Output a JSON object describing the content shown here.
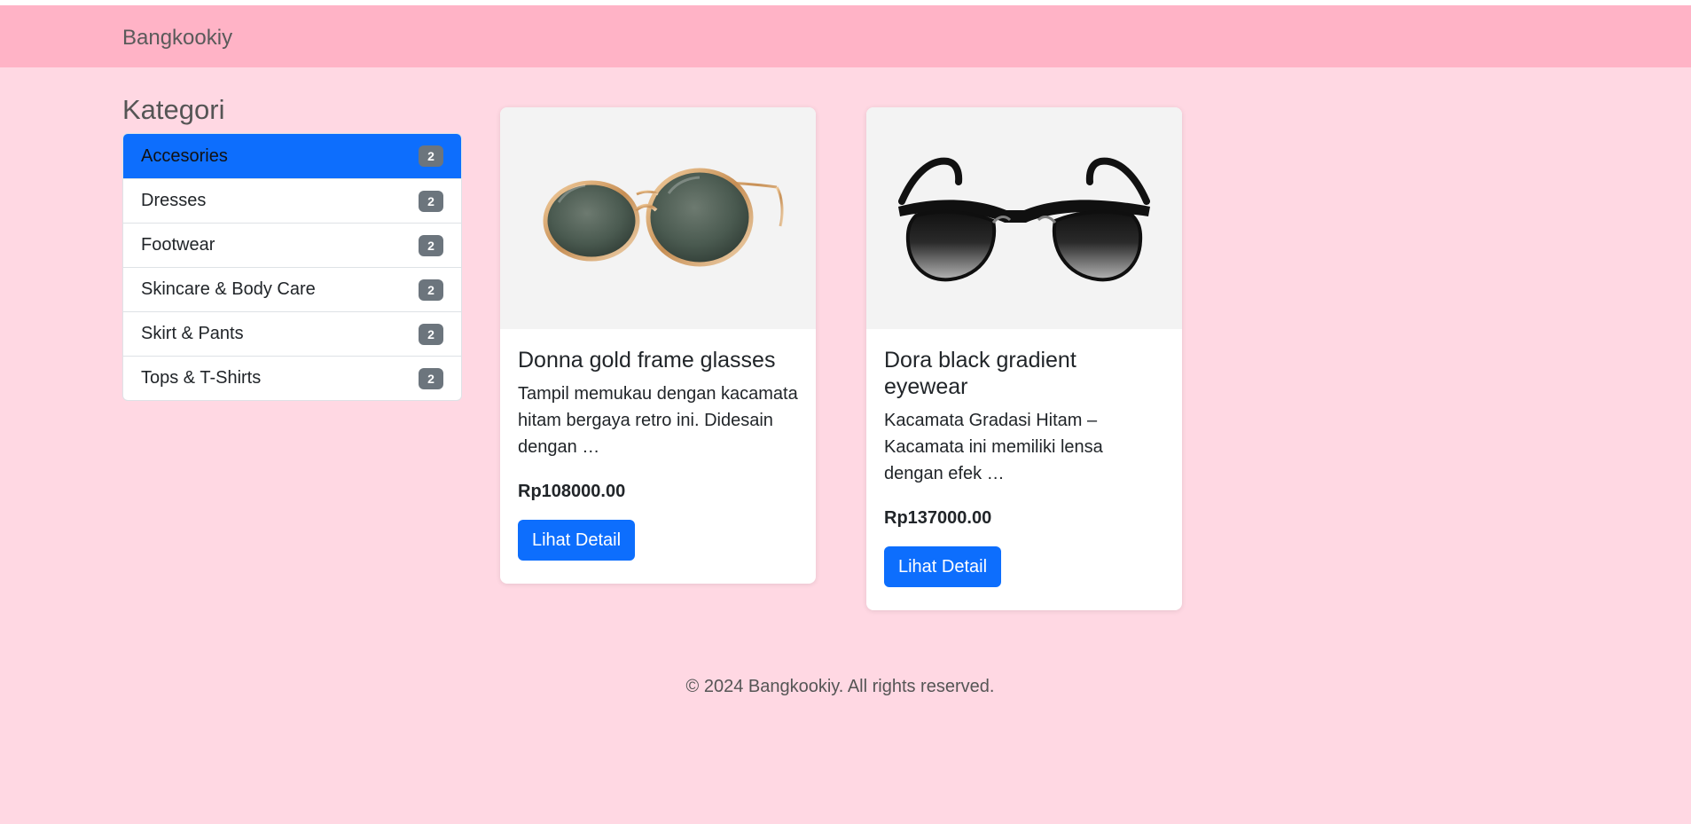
{
  "header": {
    "brand": "Bangkookiy"
  },
  "sidebar": {
    "title": "Kategori",
    "items": [
      {
        "label": "Accesories",
        "count": "2"
      },
      {
        "label": "Dresses",
        "count": "2"
      },
      {
        "label": "Footwear",
        "count": "2"
      },
      {
        "label": "Skincare & Body Care",
        "count": "2"
      },
      {
        "label": "Skirt & Pants",
        "count": "2"
      },
      {
        "label": "Tops & T-Shirts",
        "count": "2"
      }
    ]
  },
  "products": [
    {
      "name": "Donna gold frame glasses",
      "description": "Tampil memukau dengan kacamata hitam bergaya retro ini. Didesain dengan …",
      "price": "Rp108000.00",
      "button_label": "Lihat Detail",
      "image_icon": "gold-frame-sunglasses-icon"
    },
    {
      "name": "Dora black gradient eyewear",
      "description": "Kacamata Gradasi Hitam – Kacamata ini memiliki lensa dengan efek …",
      "price": "Rp137000.00",
      "button_label": "Lihat Detail",
      "image_icon": "black-gradient-sunglasses-icon"
    }
  ],
  "footer": {
    "text": "© 2024 Bangkookiy. All rights reserved."
  },
  "colors": {
    "page_background": "#ffd8e3",
    "navbar_background": "#ffb3c6",
    "primary": "#0d6efd",
    "badge": "#6c757d"
  }
}
